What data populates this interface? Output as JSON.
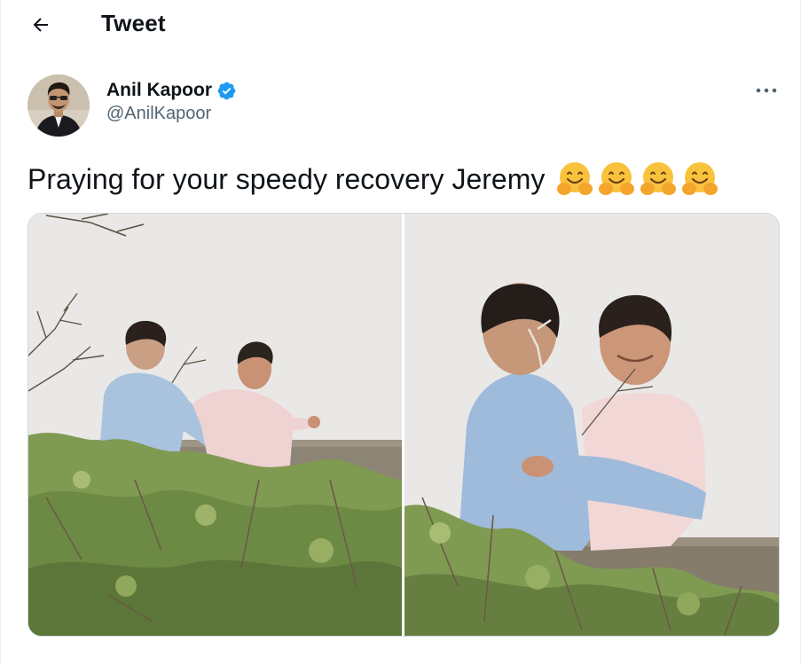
{
  "header": {
    "title": "Tweet",
    "back_icon": "arrow-left-icon"
  },
  "tweet": {
    "author": {
      "display_name": "Anil Kapoor",
      "handle": "@AnilKapoor",
      "verified": true,
      "verified_color": "#1d9bf0",
      "avatar_icon": "avatar-photo"
    },
    "more_icon": "more-options-icon",
    "text": "Praying for your speedy recovery Jeremy",
    "emojis": [
      "hugging-face-emoji",
      "hugging-face-emoji",
      "hugging-face-emoji",
      "hugging-face-emoji"
    ],
    "media": [
      {
        "description_icon": "photo-two-men-greeting-on-rooftop"
      },
      {
        "description_icon": "photo-two-men-hugging-on-rooftop"
      }
    ]
  },
  "colors": {
    "text_primary": "#0f1419",
    "text_secondary": "#536471",
    "border": "#cfd9de",
    "accent": "#1d9bf0"
  }
}
